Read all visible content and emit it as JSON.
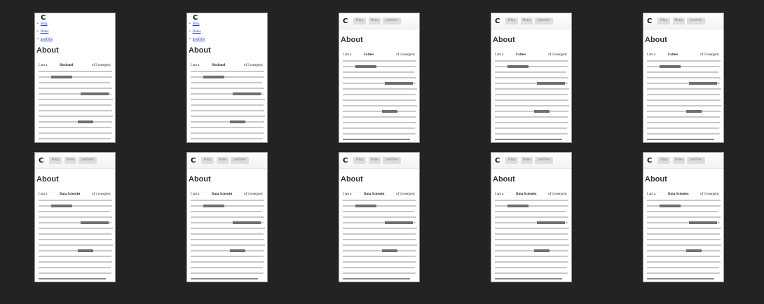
{
  "nav": {
    "logo_glyph": "C",
    "items": [
      "Blog",
      "Notes",
      "portfolio"
    ]
  },
  "page": {
    "heading": "About",
    "intro_prefix": "I am a",
    "intro_suffix": "of 2 energetic"
  },
  "thumbnails": [
    {
      "variant": "plain",
      "role": "Husband"
    },
    {
      "variant": "plain",
      "role": "Husband"
    },
    {
      "variant": "styled",
      "role": "Father"
    },
    {
      "variant": "styled",
      "role": "Father"
    },
    {
      "variant": "styled",
      "role": "Father"
    },
    {
      "variant": "styled",
      "role": "Data Scientist"
    },
    {
      "variant": "styled",
      "role": "Data Scientist"
    },
    {
      "variant": "styled",
      "role": "Data Scientist"
    },
    {
      "variant": "styled",
      "role": "Data Scientist"
    },
    {
      "variant": "styled",
      "role": "Data Scientist"
    }
  ]
}
